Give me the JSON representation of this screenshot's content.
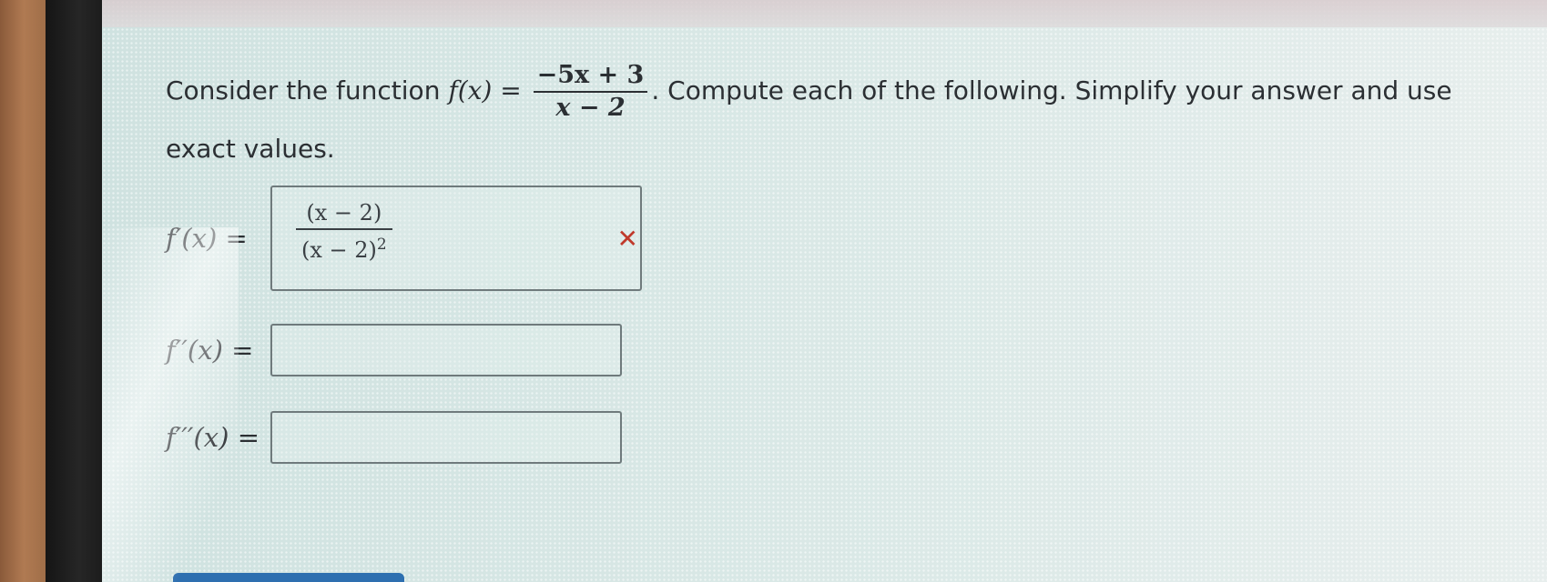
{
  "question": {
    "prefix": "Consider the function ",
    "function_lhs": "f(x) =",
    "function_numerator": "−5x + 3",
    "function_denominator": "x − 2",
    "suffix": ". Compute each of the following. Simplify your answer and use exact values."
  },
  "answers": [
    {
      "label": "f′(x) =",
      "value_numerator": "(x − 2)",
      "value_denominator_base": "(x − 2)",
      "value_denominator_exponent": "2",
      "status_icon": "✕",
      "status": "incorrect"
    },
    {
      "label": "f′′(x) =",
      "value": ""
    },
    {
      "label": "f′′′(x) =",
      "value": ""
    }
  ],
  "colors": {
    "incorrect": "#c0392b",
    "text": "#2b2f33",
    "button": "#2e6fb0"
  }
}
